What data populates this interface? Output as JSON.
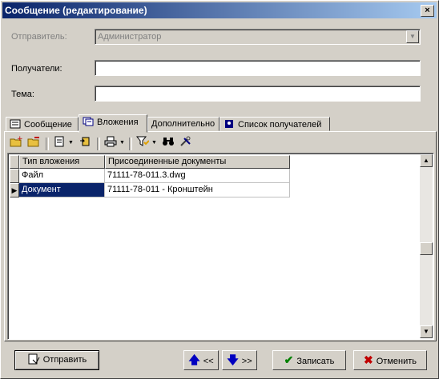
{
  "window": {
    "title": "Сообщение (редактирование)",
    "close_glyph": "×"
  },
  "form": {
    "sender_label": "Отправитель:",
    "sender_value": "Администратор",
    "recipients_label": "Получатели:",
    "recipients_value": "",
    "subject_label": "Тема:",
    "subject_value": ""
  },
  "tabs": [
    {
      "label": "Сообщение",
      "icon": "document-icon"
    },
    {
      "label": "Вложения",
      "icon": "attachments-icon",
      "active": true
    },
    {
      "label": "Дополнительно"
    },
    {
      "label": "Список получателей",
      "icon": "address-book-icon"
    }
  ],
  "table": {
    "columns": [
      "Тип вложения",
      "Присоединенные документы"
    ],
    "rows": [
      {
        "type": "Файл",
        "doc": "71111-78-011.3.dwg",
        "selected": false
      },
      {
        "type": "Документ",
        "doc": "71111-78-011 - Кронштейн",
        "selected": true
      }
    ]
  },
  "buttons": {
    "send": "Отправить",
    "prev": "<<",
    "next": ">>",
    "save": "Записать",
    "cancel": "Отменить"
  },
  "colors": {
    "selection": "#0a246a",
    "titlebar_start": "#0a246a",
    "titlebar_end": "#a6caf0"
  }
}
